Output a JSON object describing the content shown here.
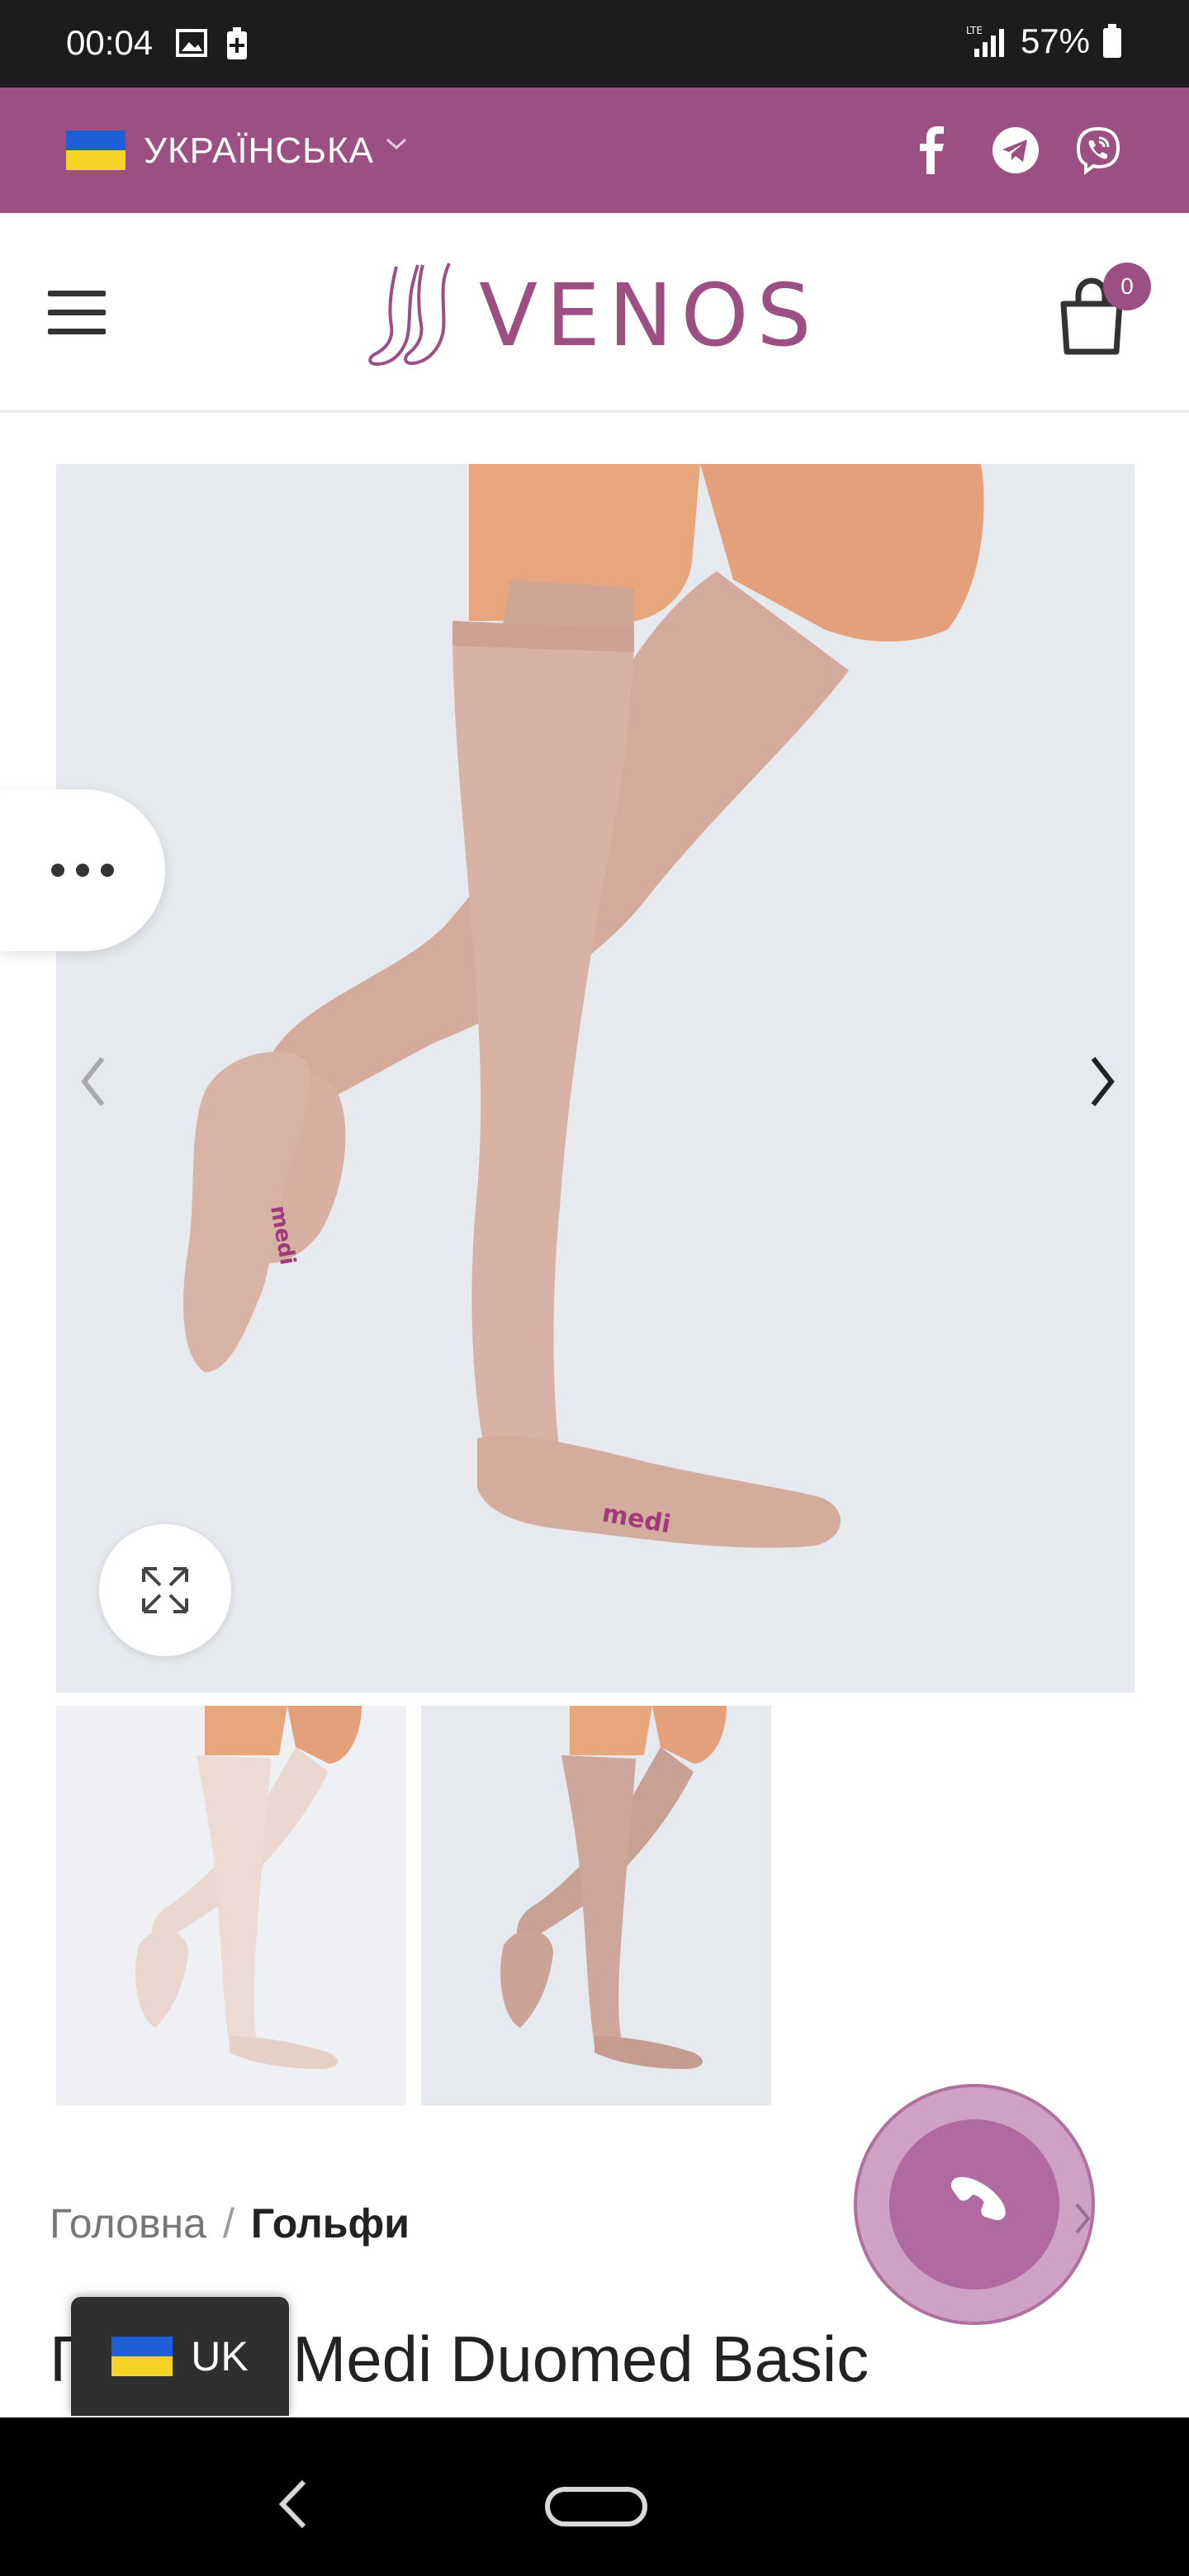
{
  "status_bar": {
    "time": "00:04",
    "network": "LTE",
    "battery": "57%"
  },
  "topbar": {
    "language_label": "УКРАЇНСЬКА",
    "flag_colors": [
      "#1f5fd6",
      "#f5d327"
    ],
    "social": [
      {
        "name": "facebook-icon"
      },
      {
        "name": "telegram-icon"
      },
      {
        "name": "viber-icon"
      }
    ]
  },
  "header": {
    "logo_text": "VENOS",
    "cart_count": "0"
  },
  "gallery": {
    "product_photo_alt": "knee-high compression socks medi",
    "sock_brand_mark": "medi",
    "thumbnails": [
      "light beige socks",
      "dark beige socks"
    ]
  },
  "breadcrumb": {
    "home": "Головна",
    "separator": "/",
    "current": "Гольфи"
  },
  "product": {
    "title": "Гольфи Medi Duomed Basic",
    "title_visible": "Г      Medi Duomed Basic"
  },
  "lang_switcher": {
    "label": "UK"
  },
  "colors": {
    "brand_purple": "#9b4f82",
    "image_bg": "#e6e9ee",
    "sock_beige": "#d9b6a8"
  }
}
